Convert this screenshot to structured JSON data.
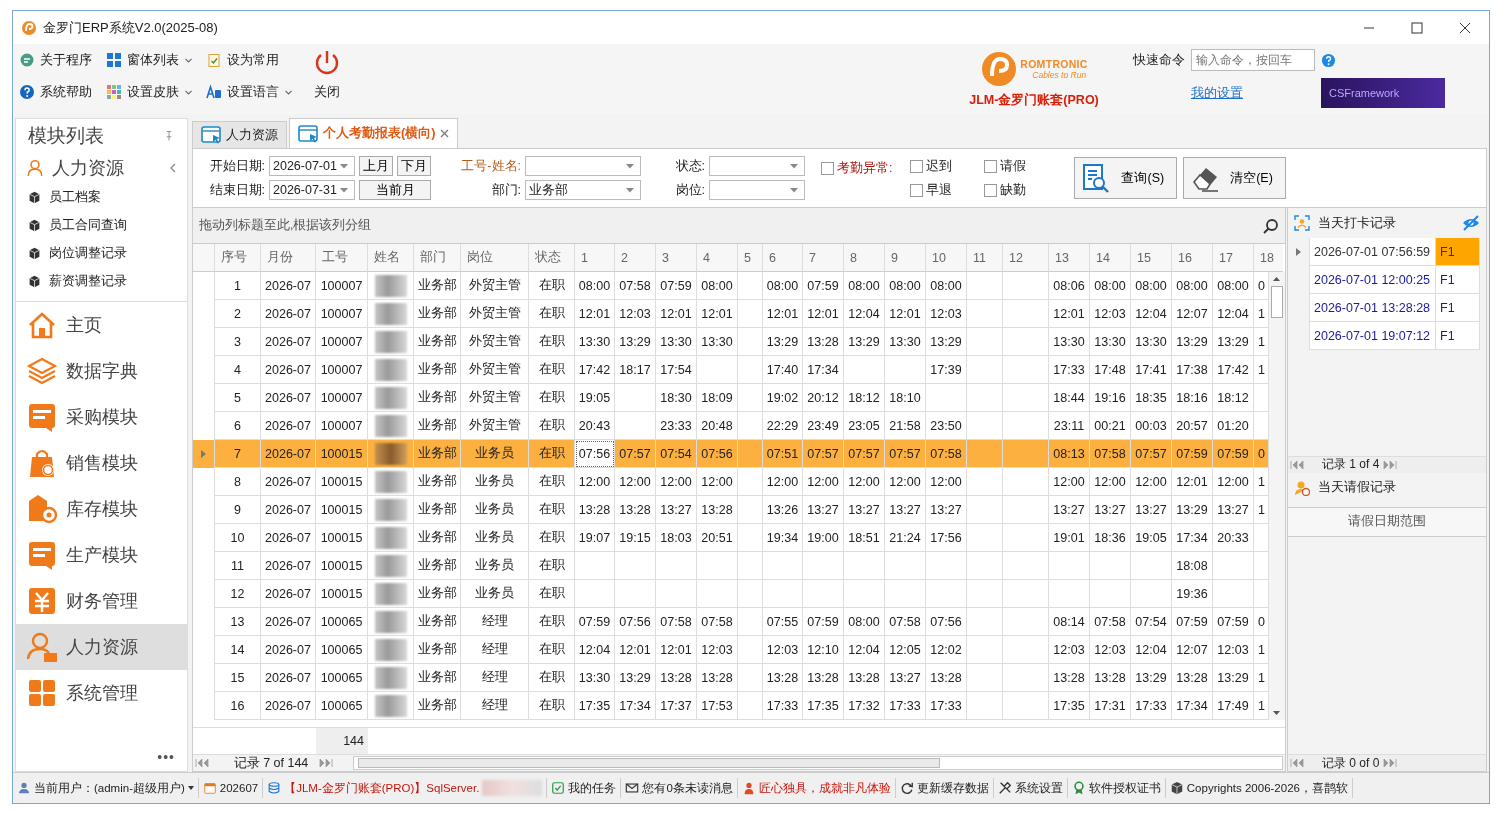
{
  "window": {
    "title": "金罗门ERP系统V2.0(2025-08)"
  },
  "toolbar": {
    "items": [
      {
        "label": "关于程序",
        "dropdown": false
      },
      {
        "label": "窗体列表",
        "dropdown": true
      },
      {
        "label": "设为常用",
        "dropdown": false
      },
      {
        "label": "系统帮助",
        "dropdown": false
      },
      {
        "label": "设置皮肤",
        "dropdown": true
      },
      {
        "label": "设置语言",
        "dropdown": true
      }
    ],
    "close_label": "关闭"
  },
  "brand": {
    "logo_name": "ROMTRONIC",
    "logo_tagline": "Cables to Run",
    "account": "JLM-金罗门账套(PRO)"
  },
  "quick_command": {
    "label": "快速命令",
    "placeholder": "输入命令，按回车",
    "settings_link": "我的设置",
    "banner": "CSFramework"
  },
  "sidebar": {
    "title": "模块列表",
    "group": {
      "label": "人力资源",
      "expanded": true,
      "children": [
        {
          "label": "员工档案"
        },
        {
          "label": "员工合同查询"
        },
        {
          "label": "岗位调整记录"
        },
        {
          "label": "薪资调整记录"
        }
      ]
    },
    "modules": [
      {
        "label": "主页",
        "selected": false
      },
      {
        "label": "数据字典",
        "selected": false
      },
      {
        "label": "采购模块",
        "selected": false
      },
      {
        "label": "销售模块",
        "selected": false
      },
      {
        "label": "库存模块",
        "selected": false
      },
      {
        "label": "生产模块",
        "selected": false
      },
      {
        "label": "财务管理",
        "selected": false
      },
      {
        "label": "人力资源",
        "selected": true
      },
      {
        "label": "系统管理",
        "selected": false
      }
    ],
    "more": "•••"
  },
  "tabs": [
    {
      "label": "人力资源",
      "selected": false,
      "closable": false
    },
    {
      "label": "个人考勤报表(横向)",
      "selected": true,
      "closable": true
    }
  ],
  "filters": {
    "start_label": "开始日期:",
    "start_value": "2026-07-01",
    "end_label": "结束日期:",
    "end_value": "2026-07-31",
    "month_buttons": [
      "上月",
      "下月"
    ],
    "current_month": "当前月",
    "employee_label": "工号-姓名:",
    "status_label": "状态:",
    "dept_label": "部门:",
    "dept_value": "业务部",
    "post_label": "岗位:",
    "abnormal": {
      "label": "考勤异常:",
      "checked": false
    },
    "options": [
      {
        "label": "迟到",
        "checked": false
      },
      {
        "label": "早退",
        "checked": false
      },
      {
        "label": "请假",
        "checked": false
      },
      {
        "label": "缺勤",
        "checked": false
      }
    ],
    "query_button": "查询(S)",
    "clear_button": "清空(E)"
  },
  "grid": {
    "group_hint": "拖动列标题至此,根据该列分组",
    "columns": [
      "序号",
      "月份",
      "工号",
      "姓名",
      "部门",
      "岗位",
      "状态",
      "1",
      "2",
      "3",
      "4",
      "5",
      "6",
      "7",
      "8",
      "9",
      "10",
      "11",
      "12",
      "13",
      "14",
      "15",
      "16",
      "17",
      "18"
    ],
    "rows": [
      {
        "no": "1",
        "month": "2026-07",
        "id": "100007",
        "dept": "业务部",
        "post": "外贸主管",
        "status": "在职",
        "selected": false,
        "days": {
          "d1": "08:00",
          "d2": "07:58",
          "d3": "07:59",
          "d4": "08:00",
          "d6": "08:00",
          "d7": "07:59",
          "d8": "08:00",
          "d9": "08:00",
          "d10": "08:00",
          "d13": "08:06",
          "d14": "08:00",
          "d15": "08:00",
          "d16": "08:00",
          "d17": "08:00",
          "d18": "0"
        }
      },
      {
        "no": "2",
        "month": "2026-07",
        "id": "100007",
        "dept": "业务部",
        "post": "外贸主管",
        "status": "在职",
        "selected": false,
        "days": {
          "d1": "12:01",
          "d2": "12:03",
          "d3": "12:01",
          "d4": "12:01",
          "d6": "12:01",
          "d7": "12:01",
          "d8": "12:04",
          "d9": "12:01",
          "d10": "12:03",
          "d13": "12:01",
          "d14": "12:03",
          "d15": "12:04",
          "d16": "12:07",
          "d17": "12:04",
          "d18": "1"
        }
      },
      {
        "no": "3",
        "month": "2026-07",
        "id": "100007",
        "dept": "业务部",
        "post": "外贸主管",
        "status": "在职",
        "selected": false,
        "days": {
          "d1": "13:30",
          "d2": "13:29",
          "d3": "13:30",
          "d4": "13:30",
          "d6": "13:29",
          "d7": "13:28",
          "d8": "13:29",
          "d9": "13:30",
          "d10": "13:29",
          "d13": "13:30",
          "d14": "13:30",
          "d15": "13:30",
          "d16": "13:29",
          "d17": "13:29",
          "d18": "1"
        }
      },
      {
        "no": "4",
        "month": "2026-07",
        "id": "100007",
        "dept": "业务部",
        "post": "外贸主管",
        "status": "在职",
        "selected": false,
        "days": {
          "d1": "17:42",
          "d2": "18:17",
          "d3": "17:54",
          "d6": "17:40",
          "d7": "17:34",
          "d10": "17:39",
          "d13": "17:33",
          "d14": "17:48",
          "d15": "17:41",
          "d16": "17:38",
          "d17": "17:42",
          "d18": "1"
        }
      },
      {
        "no": "5",
        "month": "2026-07",
        "id": "100007",
        "dept": "业务部",
        "post": "外贸主管",
        "status": "在职",
        "selected": false,
        "days": {
          "d1": "19:05",
          "d3": "18:30",
          "d4": "18:09",
          "d6": "19:02",
          "d7": "20:12",
          "d8": "18:12",
          "d9": "18:10",
          "d13": "18:44",
          "d14": "19:16",
          "d15": "18:35",
          "d16": "18:16",
          "d17": "18:12"
        }
      },
      {
        "no": "6",
        "month": "2026-07",
        "id": "100007",
        "dept": "业务部",
        "post": "外贸主管",
        "status": "在职",
        "selected": false,
        "days": {
          "d1": "20:43",
          "d3": "23:33",
          "d4": "20:48",
          "d6": "22:29",
          "d7": "23:49",
          "d8": "23:05",
          "d9": "21:58",
          "d10": "23:50",
          "d13": "23:11",
          "d14": "00:21",
          "d15": "00:03",
          "d16": "20:57",
          "d17": "01:20"
        }
      },
      {
        "no": "7",
        "month": "2026-07",
        "id": "100015",
        "dept": "业务部",
        "post": "业务员",
        "status": "在职",
        "selected": true,
        "days": {
          "d1": "07:56",
          "d2": "07:57",
          "d3": "07:54",
          "d4": "07:56",
          "d6": "07:51",
          "d7": "07:57",
          "d8": "07:57",
          "d9": "07:57",
          "d10": "07:58",
          "d13": "08:13",
          "d14": "07:58",
          "d15": "07:57",
          "d16": "07:59",
          "d17": "07:59",
          "d18": "0"
        }
      },
      {
        "no": "8",
        "month": "2026-07",
        "id": "100015",
        "dept": "业务部",
        "post": "业务员",
        "status": "在职",
        "selected": false,
        "days": {
          "d1": "12:00",
          "d2": "12:00",
          "d3": "12:00",
          "d4": "12:00",
          "d6": "12:00",
          "d7": "12:00",
          "d8": "12:00",
          "d9": "12:00",
          "d10": "12:00",
          "d13": "12:00",
          "d14": "12:00",
          "d15": "12:00",
          "d16": "12:01",
          "d17": "12:00",
          "d18": "1"
        }
      },
      {
        "no": "9",
        "month": "2026-07",
        "id": "100015",
        "dept": "业务部",
        "post": "业务员",
        "status": "在职",
        "selected": false,
        "days": {
          "d1": "13:28",
          "d2": "13:28",
          "d3": "13:27",
          "d4": "13:28",
          "d6": "13:26",
          "d7": "13:27",
          "d8": "13:27",
          "d9": "13:27",
          "d10": "13:27",
          "d13": "13:27",
          "d14": "13:27",
          "d15": "13:27",
          "d16": "13:29",
          "d17": "13:27",
          "d18": "1"
        }
      },
      {
        "no": "10",
        "month": "2026-07",
        "id": "100015",
        "dept": "业务部",
        "post": "业务员",
        "status": "在职",
        "selected": false,
        "days": {
          "d1": "19:07",
          "d2": "19:15",
          "d3": "18:03",
          "d4": "20:51",
          "d6": "19:34",
          "d7": "19:00",
          "d8": "18:51",
          "d9": "21:24",
          "d10": "17:56",
          "d13": "19:01",
          "d14": "18:36",
          "d15": "19:05",
          "d16": "17:34",
          "d17": "20:33"
        }
      },
      {
        "no": "11",
        "month": "2026-07",
        "id": "100015",
        "dept": "业务部",
        "post": "业务员",
        "status": "在职",
        "selected": false,
        "days": {
          "d16": "18:08"
        }
      },
      {
        "no": "12",
        "month": "2026-07",
        "id": "100015",
        "dept": "业务部",
        "post": "业务员",
        "status": "在职",
        "selected": false,
        "days": {
          "d16": "19:36"
        }
      },
      {
        "no": "13",
        "month": "2026-07",
        "id": "100065",
        "dept": "业务部",
        "post": "经理",
        "status": "在职",
        "selected": false,
        "days": {
          "d1": "07:59",
          "d2": "07:56",
          "d3": "07:58",
          "d4": "07:58",
          "d6": "07:55",
          "d7": "07:59",
          "d8": "08:00",
          "d9": "07:58",
          "d10": "07:56",
          "d13": "08:14",
          "d14": "07:58",
          "d15": "07:54",
          "d16": "07:59",
          "d17": "07:59",
          "d18": "0"
        }
      },
      {
        "no": "14",
        "month": "2026-07",
        "id": "100065",
        "dept": "业务部",
        "post": "经理",
        "status": "在职",
        "selected": false,
        "days": {
          "d1": "12:04",
          "d2": "12:01",
          "d3": "12:01",
          "d4": "12:03",
          "d6": "12:03",
          "d7": "12:10",
          "d8": "12:04",
          "d9": "12:05",
          "d10": "12:02",
          "d13": "12:03",
          "d14": "12:03",
          "d15": "12:04",
          "d16": "12:07",
          "d17": "12:03",
          "d18": "1"
        }
      },
      {
        "no": "15",
        "month": "2026-07",
        "id": "100065",
        "dept": "业务部",
        "post": "经理",
        "status": "在职",
        "selected": false,
        "days": {
          "d1": "13:30",
          "d2": "13:29",
          "d3": "13:28",
          "d4": "13:28",
          "d6": "13:28",
          "d7": "13:28",
          "d8": "13:28",
          "d9": "13:27",
          "d10": "13:28",
          "d13": "13:28",
          "d14": "13:28",
          "d15": "13:29",
          "d16": "13:28",
          "d17": "13:29",
          "d18": "1"
        }
      },
      {
        "no": "16",
        "month": "2026-07",
        "id": "100065",
        "dept": "业务部",
        "post": "经理",
        "status": "在职",
        "selected": false,
        "days": {
          "d1": "17:35",
          "d2": "17:34",
          "d3": "17:37",
          "d4": "17:53",
          "d6": "17:33",
          "d7": "17:35",
          "d8": "17:32",
          "d9": "17:33",
          "d10": "17:33",
          "d13": "17:35",
          "d14": "17:31",
          "d15": "17:33",
          "d16": "17:34",
          "d17": "17:49",
          "d18": "1"
        }
      }
    ],
    "footer_sum": "144",
    "pager": "记录 7 of 144"
  },
  "punch_panel": {
    "title": "当天打卡记录",
    "records": [
      {
        "time": "2026-07-01 07:56:59",
        "device": "F1",
        "selected": true
      },
      {
        "time": "2026-07-01 12:00:25",
        "device": "F1",
        "selected": false
      },
      {
        "time": "2026-07-01 13:28:28",
        "device": "F1",
        "selected": false
      },
      {
        "time": "2026-07-01 19:07:12",
        "device": "F1",
        "selected": false
      }
    ],
    "pager": "记录 1 of 4"
  },
  "leave_panel": {
    "title": "当天请假记录",
    "columns": [
      "请假日期范围"
    ],
    "pager": "记录 0 of 0"
  },
  "status_bar": {
    "items": [
      {
        "label": "当前用户：(admin-超级用户)",
        "dropdown": true
      },
      {
        "label": "202607",
        "dropdown": false
      },
      {
        "label": "【JLM-金罗门账套(PRO)】SqlServer.",
        "dropdown": false
      },
      {
        "label": "我的任务",
        "dropdown": false
      },
      {
        "label": "您有0条未读消息",
        "dropdown": false
      },
      {
        "label": "匠心独具，成就非凡体验",
        "dropdown": false
      },
      {
        "label": "更新缓存数据",
        "dropdown": false
      },
      {
        "label": "系统设置",
        "dropdown": false
      },
      {
        "label": "软件授权证书",
        "dropdown": false
      },
      {
        "label": "Copyrights 2006-2026，喜鹊软",
        "dropdown": false
      }
    ]
  }
}
